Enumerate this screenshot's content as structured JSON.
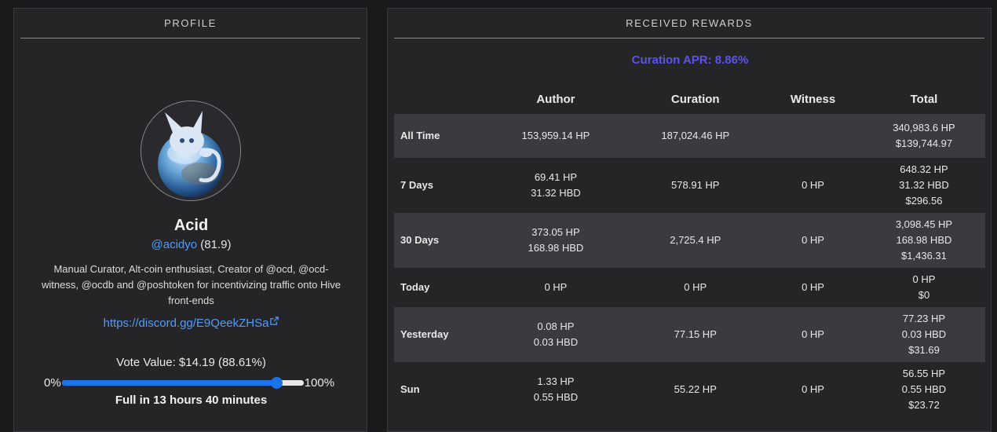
{
  "profile": {
    "header": "PROFILE",
    "name": "Acid",
    "handle": "@acidyo",
    "reputation": "(81.9)",
    "about": "Manual Curator, Alt-coin enthusiast, Creator of @ocd, @ocd-witness, @ocdb and @poshtoken for incentivizing traffic onto Hive front-ends",
    "website": "https://discord.gg/E9QeekZHSa",
    "vote_value_text": "Vote Value: $14.19 (88.61%)",
    "slider_min": "0%",
    "slider_max": "100%",
    "slider_percent": 88.61,
    "recharge_text": "Full in 13 hours 40 minutes"
  },
  "rewards": {
    "header": "RECEIVED REWARDS",
    "apr": "Curation APR: 8.86%",
    "columns": [
      "",
      "Author",
      "Curation",
      "Witness",
      "Total"
    ],
    "rows": [
      {
        "label": "All Time",
        "author": [
          "153,959.14 HP"
        ],
        "curation": [
          "187,024.46 HP"
        ],
        "witness": [],
        "total": [
          "340,983.6 HP",
          "$139,744.97"
        ]
      },
      {
        "label": "7 Days",
        "author": [
          "69.41 HP",
          "31.32 HBD"
        ],
        "curation": [
          "578.91 HP"
        ],
        "witness": [
          "0 HP"
        ],
        "total": [
          "648.32 HP",
          "31.32 HBD",
          "$296.56"
        ]
      },
      {
        "label": "30 Days",
        "author": [
          "373.05 HP",
          "168.98 HBD"
        ],
        "curation": [
          "2,725.4 HP"
        ],
        "witness": [
          "0 HP"
        ],
        "total": [
          "3,098.45 HP",
          "168.98 HBD",
          "$1,436.31"
        ]
      },
      {
        "label": "Today",
        "author": [
          "0 HP"
        ],
        "curation": [
          "0 HP"
        ],
        "witness": [
          "0 HP"
        ],
        "total": [
          "0 HP",
          "$0"
        ]
      },
      {
        "label": "Yesterday",
        "author": [
          "0.08 HP",
          "0.03 HBD"
        ],
        "curation": [
          "77.15 HP"
        ],
        "witness": [
          "0 HP"
        ],
        "total": [
          "77.23 HP",
          "0.03 HBD",
          "$31.69"
        ]
      },
      {
        "label": "Sun",
        "author": [
          "1.33 HP",
          "0.55 HBD"
        ],
        "curation": [
          "55.22 HP"
        ],
        "witness": [
          "0 HP"
        ],
        "total": [
          "56.55 HP",
          "0.55 HBD",
          "$23.72"
        ]
      }
    ]
  },
  "colors": {
    "accent_link": "#4f9bff",
    "apr": "#5a55e6",
    "slider": "#1a73e8",
    "row_stripe": "#3a3a3f"
  },
  "icons": {
    "avatar": "avatar-image",
    "website": "external-link-icon"
  }
}
